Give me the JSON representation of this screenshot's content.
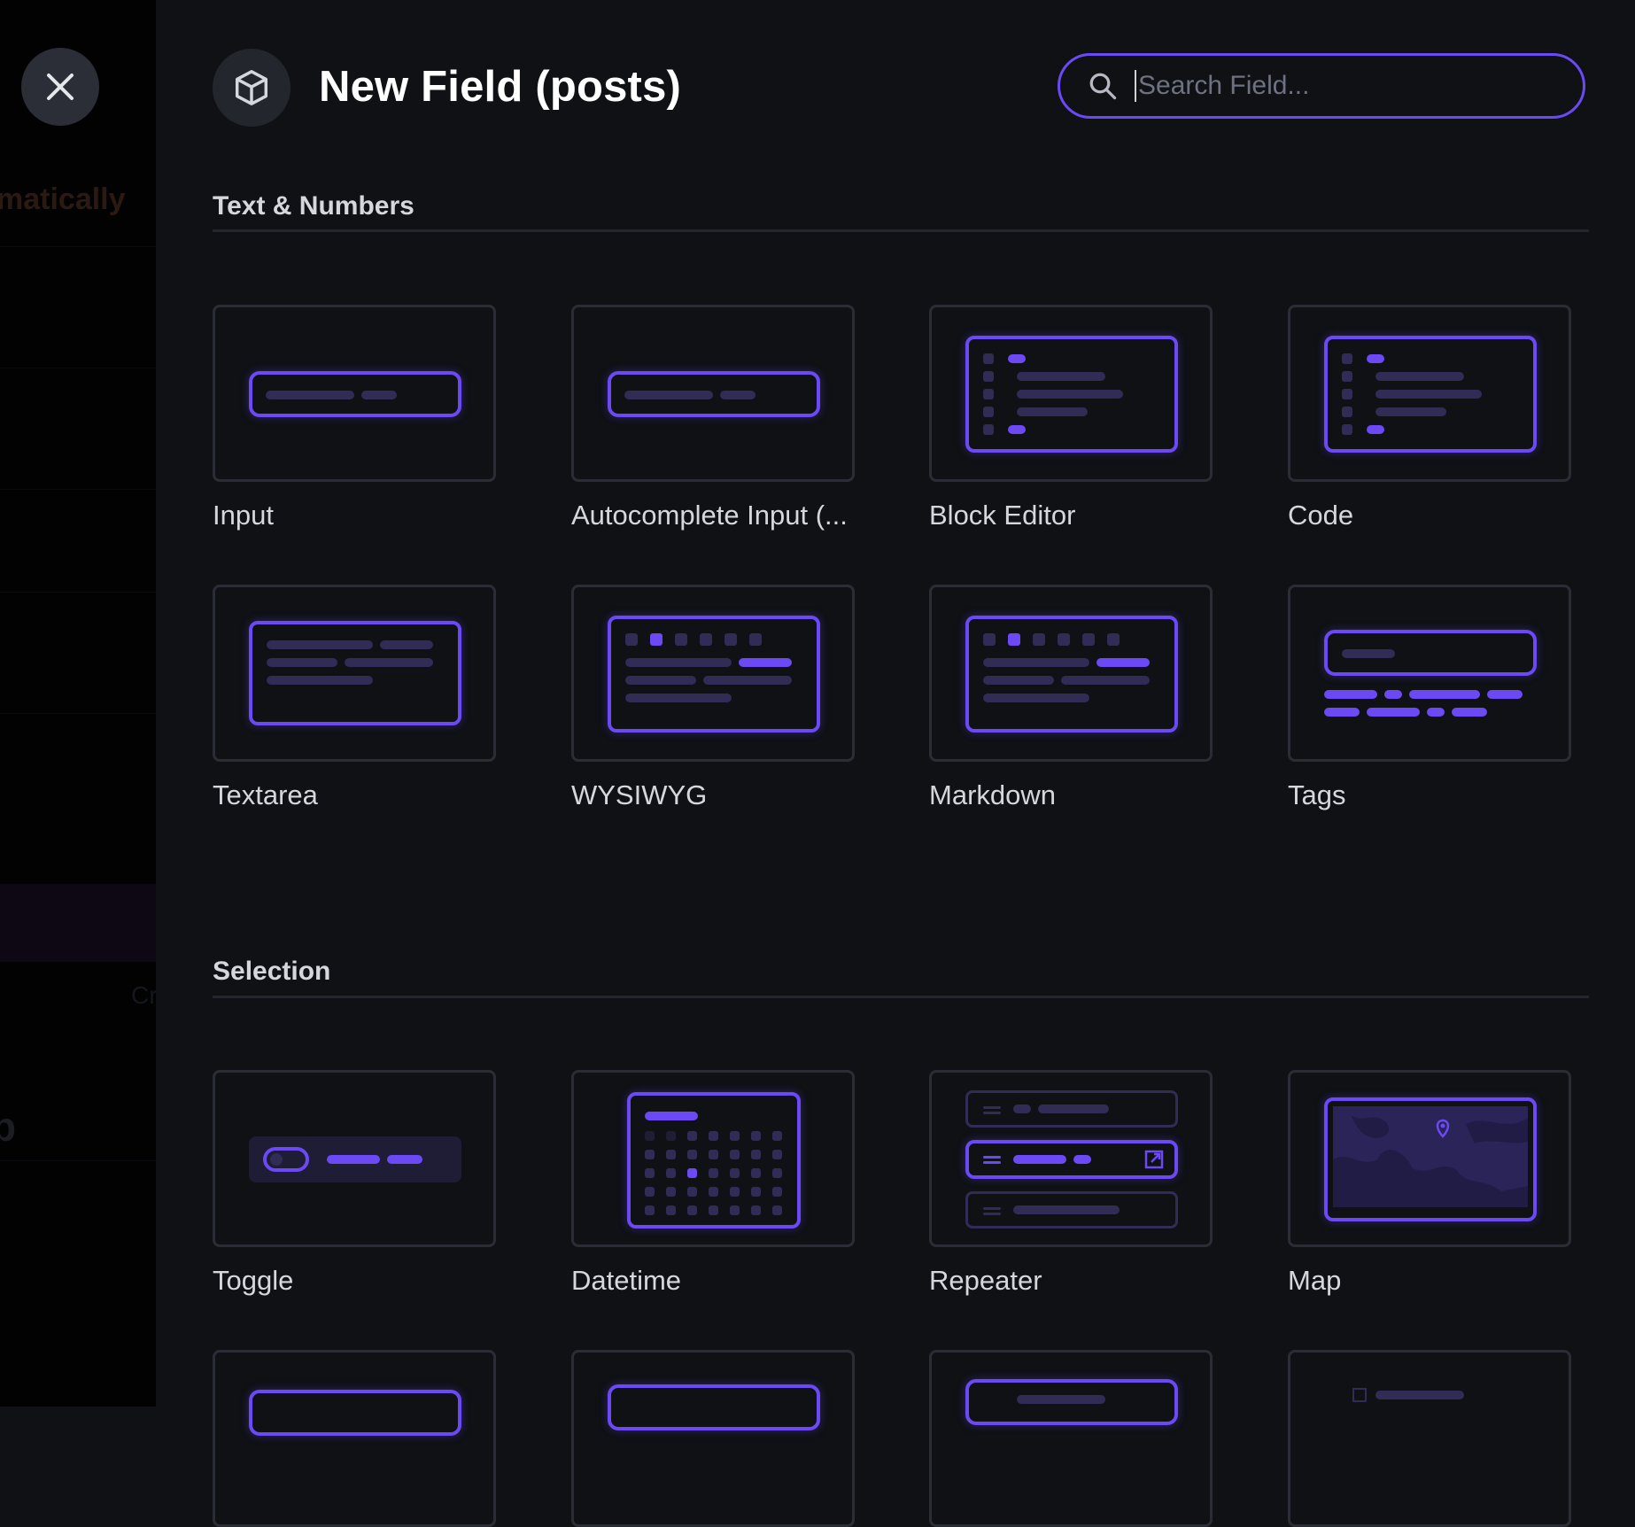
{
  "backdrop": {
    "ghost_text": "matically",
    "ghost_cr": "Cr",
    "ghost_p": "p"
  },
  "header": {
    "title": "New Field (posts)",
    "icon": "cube-icon",
    "close_icon": "close-icon",
    "search": {
      "placeholder": "Search Field...",
      "value": "",
      "icon": "search-icon"
    }
  },
  "sections": [
    {
      "title": "Text & Numbers",
      "cards": [
        {
          "label": "Input"
        },
        {
          "label": "Autocomplete Input (..."
        },
        {
          "label": "Block Editor"
        },
        {
          "label": "Code"
        },
        {
          "label": "Textarea"
        },
        {
          "label": "WYSIWYG"
        },
        {
          "label": "Markdown"
        },
        {
          "label": "Tags"
        }
      ]
    },
    {
      "title": "Selection",
      "cards": [
        {
          "label": "Toggle"
        },
        {
          "label": "Datetime"
        },
        {
          "label": "Repeater"
        },
        {
          "label": "Map"
        }
      ]
    }
  ],
  "colors": {
    "accent": "#6b49f4",
    "muted_bar": "#302c55",
    "background": "#0f1115",
    "card_border": "#2a2d35"
  }
}
